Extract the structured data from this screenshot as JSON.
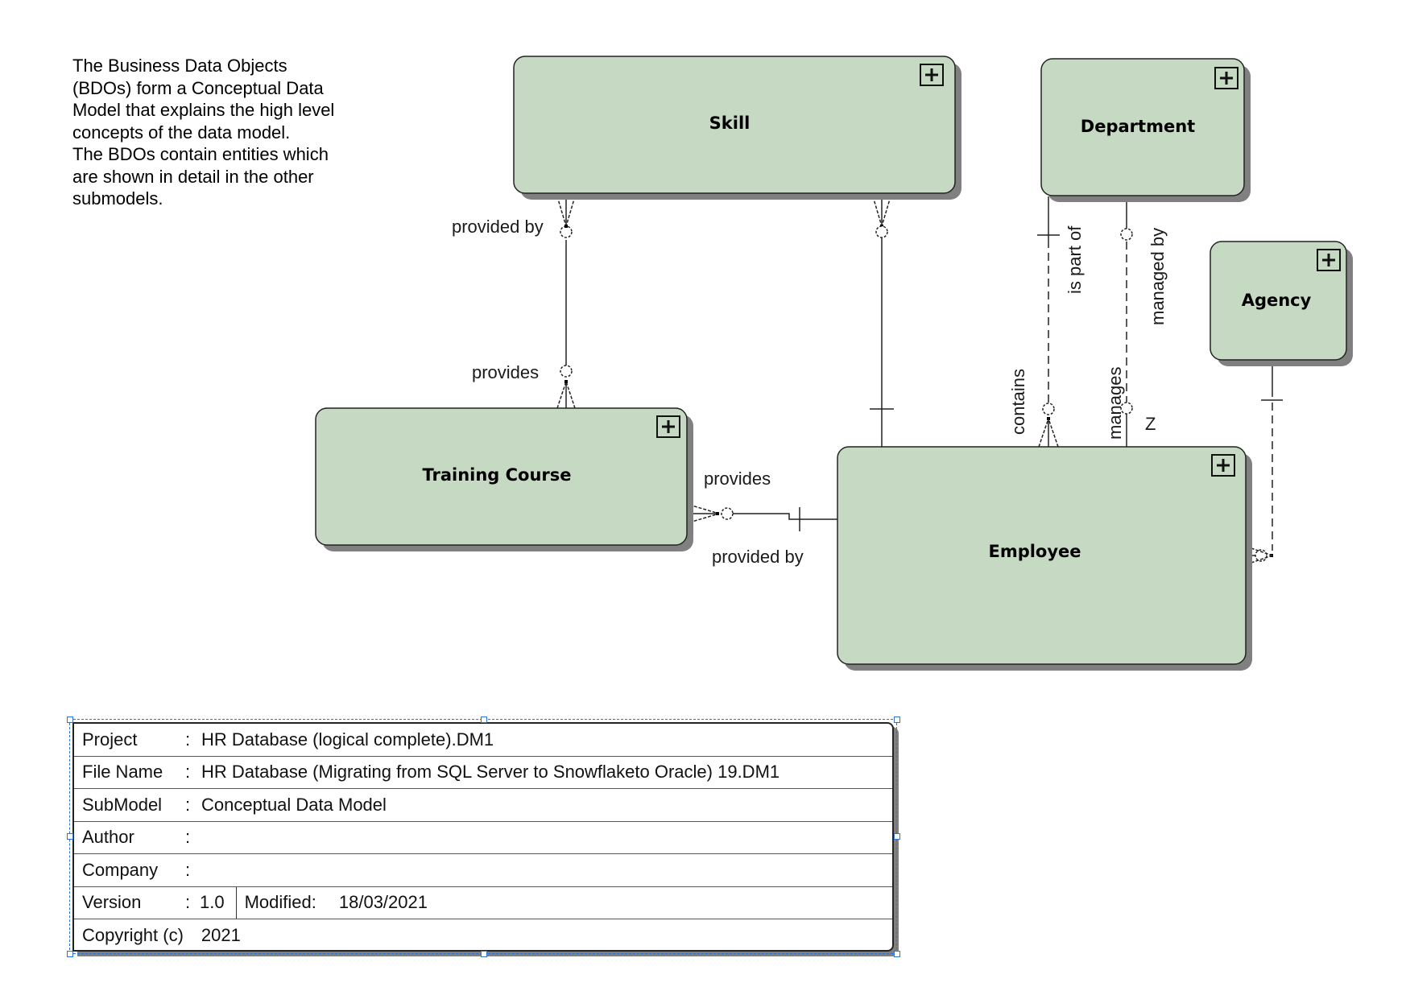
{
  "note": {
    "text": "The Business Data Objects\n(BDOs) form a Conceptual Data\nModel that explains the high level\nconcepts of the data model.\nThe BDOs contain entities which\nare shown in detail in the other\nsubmodels."
  },
  "colors": {
    "entity_fill": "#c6d9c3",
    "entity_border": "#222222",
    "shadow": "#808080",
    "selection": "#2b74d6"
  },
  "entities": {
    "skill": {
      "name": "Skill",
      "icon": "expand-plus-icon"
    },
    "department": {
      "name": "Department",
      "icon": "expand-plus-icon"
    },
    "agency": {
      "name": "Agency",
      "icon": "expand-plus-icon"
    },
    "training_course": {
      "name": "Training Course",
      "icon": "expand-plus-icon"
    },
    "employee": {
      "name": "Employee",
      "icon": "expand-plus-icon"
    }
  },
  "relationships": {
    "skill_training": {
      "from_label": "provided by",
      "to_label": "provides",
      "style": "solid"
    },
    "training_employee": {
      "from_label": "provides",
      "to_label": "provided by",
      "style": "solid"
    },
    "skill_employee": {
      "style": "solid"
    },
    "department_employee_part": {
      "from_label": "is part of",
      "to_label": "contains",
      "style": "dashed"
    },
    "department_employee_manage": {
      "from_label": "managed by",
      "to_label": "manages",
      "annotation": "Z",
      "style": "dashed"
    },
    "agency_employee": {
      "style": "dashed"
    }
  },
  "title_block": {
    "rows": [
      {
        "key": "Project",
        "sep": ":",
        "value": "HR Database (logical complete).DM1"
      },
      {
        "key": "File Name",
        "sep": ":",
        "value": "HR Database (Migrating from SQL Server to Snowflaketo Oracle) 19.DM1"
      },
      {
        "key": "SubModel",
        "sep": ":",
        "value": "Conceptual Data Model"
      },
      {
        "key": "Author",
        "sep": ":",
        "value": ""
      },
      {
        "key": "Company",
        "sep": ":",
        "value": ""
      }
    ],
    "version": {
      "key": "Version",
      "sep": ":",
      "value": "1.0",
      "modified_label": "Modified:",
      "modified_value": "18/03/2021"
    },
    "copyright": {
      "key": "Copyright (c)",
      "value": "2021"
    }
  }
}
